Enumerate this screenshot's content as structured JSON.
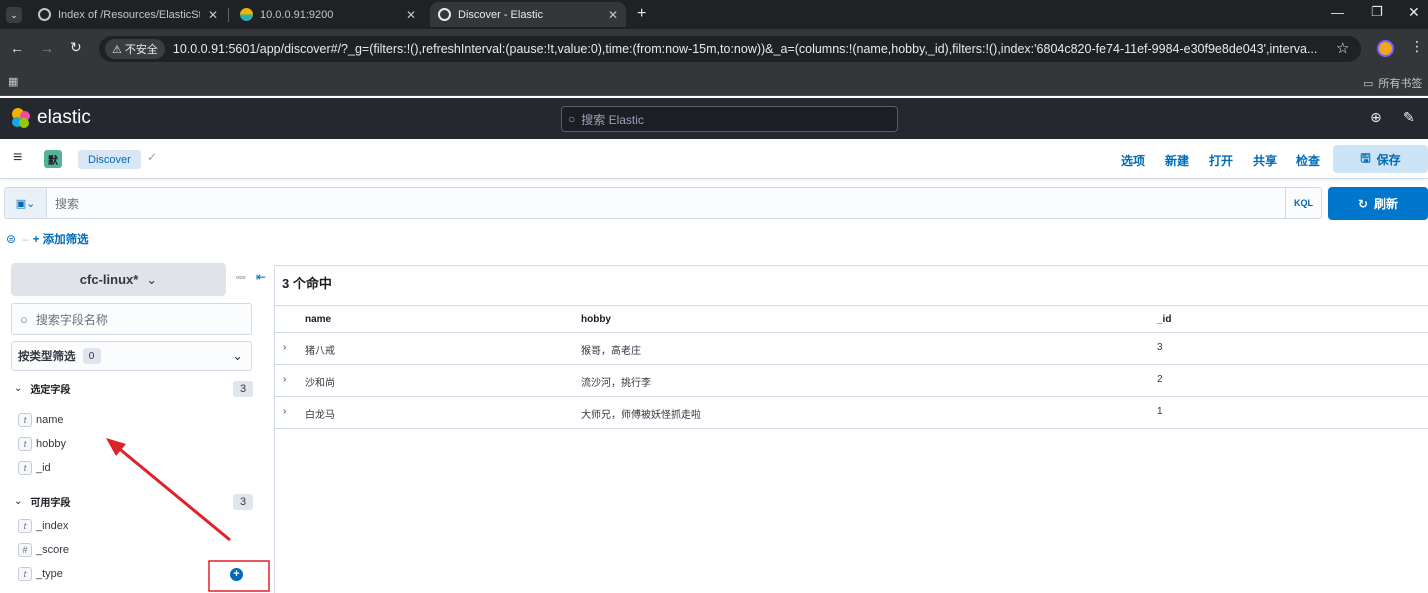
{
  "browser": {
    "tabs": [
      {
        "title": "Index of /Resources/ElasticSt",
        "active": false
      },
      {
        "title": "10.0.0.91:9200",
        "active": false
      },
      {
        "title": "Discover - Elastic",
        "active": true
      }
    ],
    "insecure_label": "不安全",
    "url": "10.0.0.91:5601/app/discover#/?_g=(filters:!(),refreshInterval:(pause:!t,value:0),time:(from:now-15m,to:now))&_a=(columns:!(name,hobby,_id),filters:!(),index:'6804c820-fe74-11ef-9984-e30f9e8de043',interva...",
    "bookmarks_label": "所有书签"
  },
  "kibana": {
    "logo_text": "elastic",
    "search_placeholder": "搜索 Elastic",
    "space_initial": "默",
    "breadcrumb": "Discover",
    "actions": [
      "选项",
      "新建",
      "打开",
      "共享",
      "检查"
    ],
    "save_label": "保存",
    "query_placeholder": "搜索",
    "kql_label": "KQL",
    "refresh_label": "刷新",
    "add_filter_label": "+ 添加筛选"
  },
  "sidebar": {
    "index_pattern": "cfc-linux*",
    "field_search_placeholder": "搜索字段名称",
    "filter_by_type": "按类型筛选",
    "filter_count": "0",
    "selected_title": "选定字段",
    "selected_count": "3",
    "selected_fields": [
      {
        "type": "t",
        "name": "name"
      },
      {
        "type": "t",
        "name": "hobby"
      },
      {
        "type": "t",
        "name": "_id"
      }
    ],
    "available_title": "可用字段",
    "available_count": "3",
    "available_fields": [
      {
        "type": "t",
        "name": "_index"
      },
      {
        "type": "#",
        "name": "_score"
      },
      {
        "type": "t",
        "name": "_type"
      }
    ]
  },
  "results": {
    "hits_label": "3 个命中",
    "columns": [
      "name",
      "hobby",
      "_id"
    ],
    "rows": [
      {
        "name": "猪八戒",
        "hobby": "猴哥，高老庄",
        "id": "3"
      },
      {
        "name": "沙和尚",
        "hobby": "流沙河，挑行李",
        "id": "2"
      },
      {
        "name": "白龙马",
        "hobby": "大师兄，师傅被妖怪抓走啦",
        "id": "1"
      }
    ]
  },
  "colors": {
    "accent": "#0077cc",
    "annotation_red": "#e0202a",
    "kibana_header": "#25282f"
  }
}
